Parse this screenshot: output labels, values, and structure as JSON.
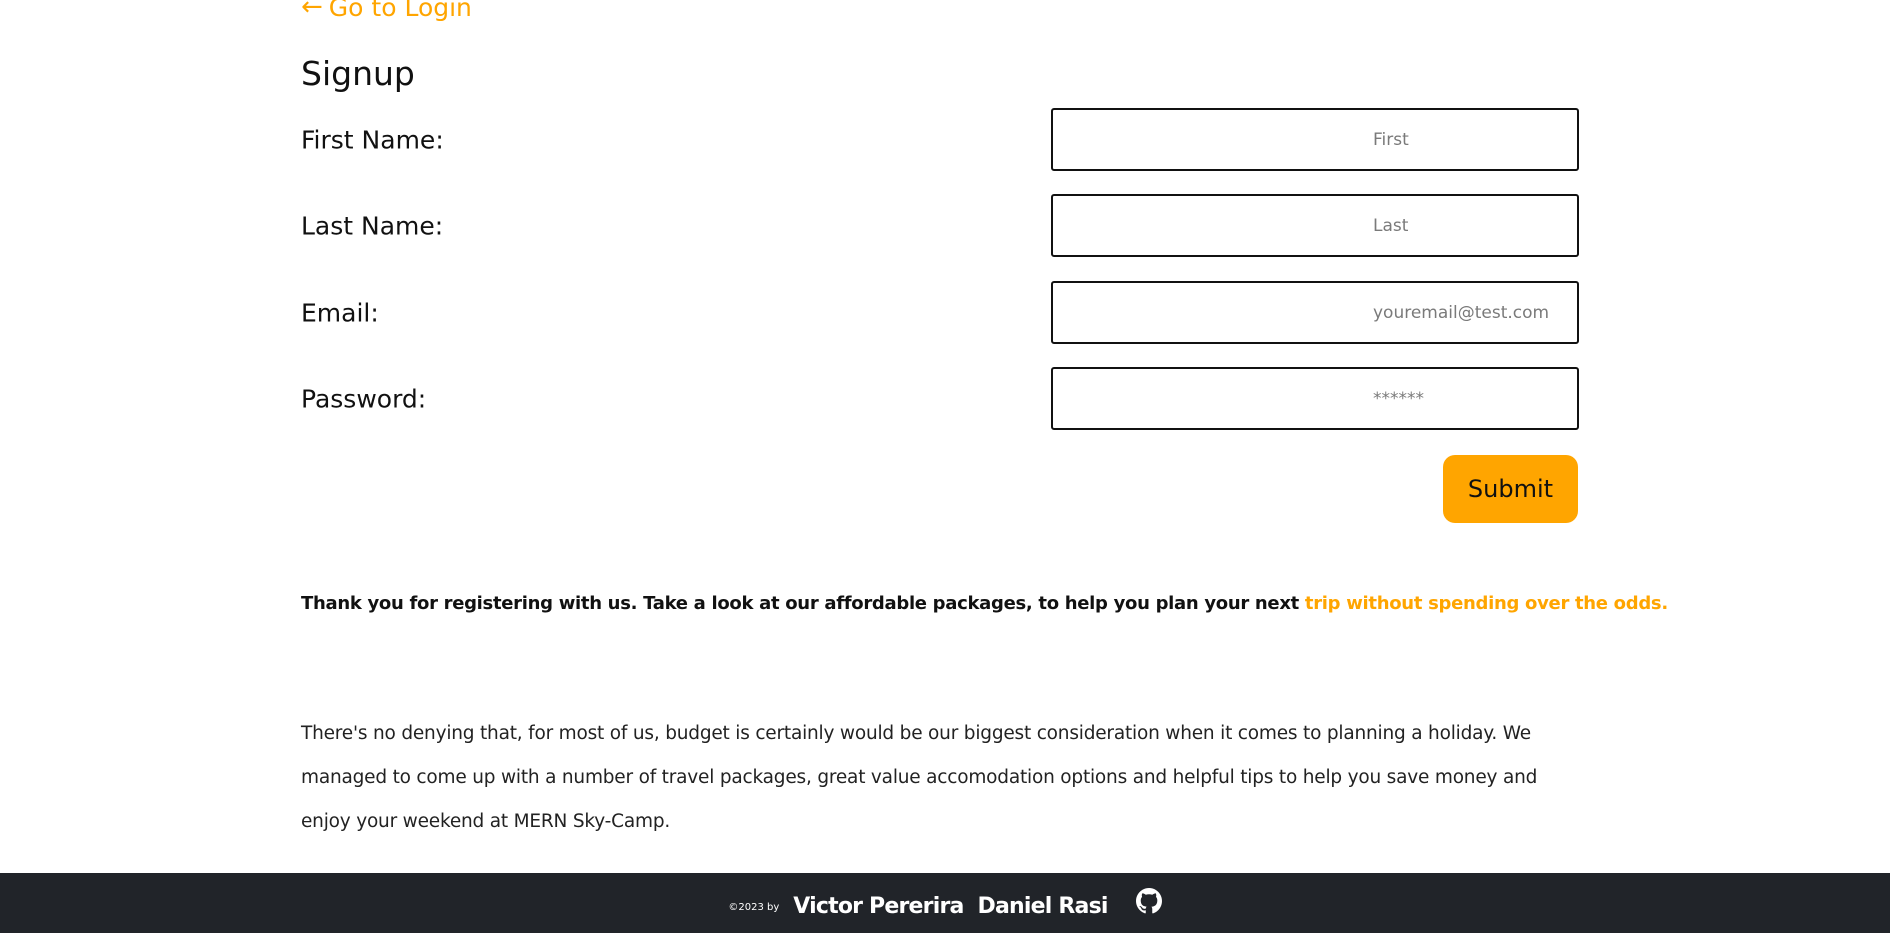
{
  "nav": {
    "back_arrow": "←",
    "back_label": "Go to Login"
  },
  "signup": {
    "title": "Signup",
    "fields": {
      "first": {
        "label": "First Name:",
        "placeholder": "First",
        "value": ""
      },
      "last": {
        "label": "Last Name:",
        "placeholder": "Last",
        "value": ""
      },
      "email": {
        "label": "Email:",
        "placeholder": "youremail@test.com",
        "value": ""
      },
      "password": {
        "label": "Password:",
        "placeholder": "******",
        "value": ""
      }
    },
    "submit_label": "Submit"
  },
  "thanks": {
    "text": "Thank you for registering with us. Take a look at our affordable packages, to help you plan your next ",
    "highlight": "trip without spending over the odds."
  },
  "about": {
    "text": "There's no denying that, for most of us, budget is certainly would be our biggest consideration when it comes to planning a holiday. We managed to come up with a number of travel packages, great value accomodation options and helpful tips to help you save money and enjoy your weekend at MERN Sky-Camp."
  },
  "footer": {
    "copyright": "©2023 by",
    "authors": [
      "Victor Pererira",
      "Daniel Rasi"
    ],
    "github_icon": "github-icon"
  },
  "colors": {
    "accent": "#ffa500",
    "footer_bg": "#212429",
    "text": "#111111"
  }
}
